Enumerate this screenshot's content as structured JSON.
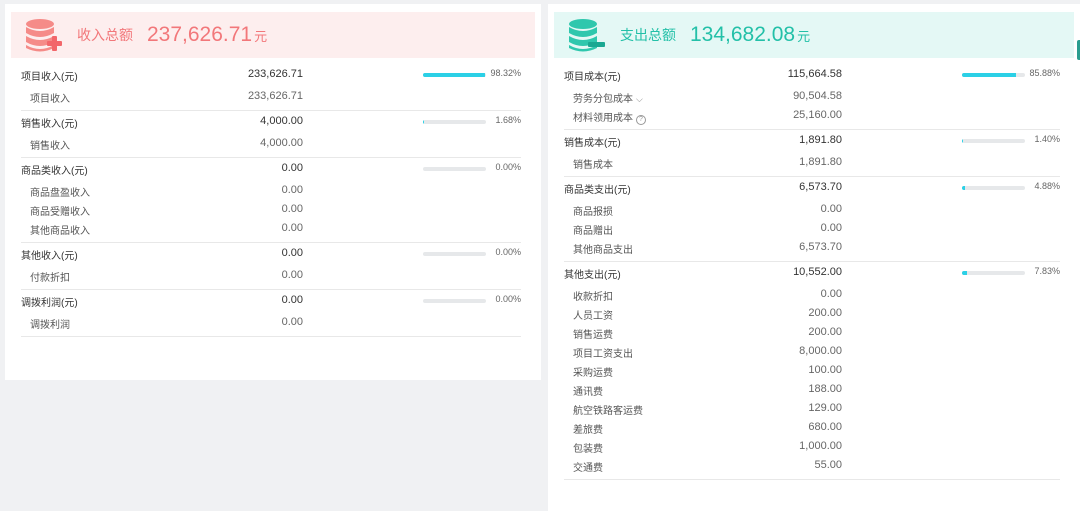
{
  "income": {
    "title": "收入总额",
    "total": "237,626.71",
    "unit": "元",
    "color": "#f2777a",
    "groups": [
      {
        "label": "项目收入(元)",
        "value": "233,626.71",
        "percent": "98.32%",
        "ratio": 0.9832,
        "items": [
          {
            "label": "项目收入",
            "value": "233,626.71"
          }
        ]
      },
      {
        "label": "销售收入(元)",
        "value": "4,000.00",
        "percent": "1.68%",
        "ratio": 0.0168,
        "items": [
          {
            "label": "销售收入",
            "value": "4,000.00"
          }
        ]
      },
      {
        "label": "商品类收入(元)",
        "value": "0.00",
        "percent": "0.00%",
        "ratio": 0,
        "items": [
          {
            "label": "商品盘盈收入",
            "value": "0.00"
          },
          {
            "label": "商品受赠收入",
            "value": "0.00"
          },
          {
            "label": "其他商品收入",
            "value": "0.00"
          }
        ]
      },
      {
        "label": "其他收入(元)",
        "value": "0.00",
        "percent": "0.00%",
        "ratio": 0,
        "items": [
          {
            "label": "付款折扣",
            "value": "0.00"
          }
        ]
      },
      {
        "label": "调拨利润(元)",
        "value": "0.00",
        "percent": "0.00%",
        "ratio": 0,
        "items": [
          {
            "label": "调拨利润",
            "value": "0.00"
          }
        ]
      }
    ]
  },
  "expense": {
    "title": "支出总额",
    "total": "134,682.08",
    "unit": "元",
    "color": "#23c0a8",
    "groups": [
      {
        "label": "项目成本(元)",
        "value": "115,664.58",
        "percent": "85.88%",
        "ratio": 0.8588,
        "items": [
          {
            "label": "劳务分包成本",
            "value": "90,504.58",
            "icon": "chevron-down-icon"
          },
          {
            "label": "材料领用成本",
            "value": "25,160.00",
            "icon": "help-icon"
          }
        ]
      },
      {
        "label": "销售成本(元)",
        "value": "1,891.80",
        "percent": "1.40%",
        "ratio": 0.014,
        "items": [
          {
            "label": "销售成本",
            "value": "1,891.80"
          }
        ]
      },
      {
        "label": "商品类支出(元)",
        "value": "6,573.70",
        "percent": "4.88%",
        "ratio": 0.0488,
        "items": [
          {
            "label": "商品报损",
            "value": "0.00"
          },
          {
            "label": "商品赠出",
            "value": "0.00"
          },
          {
            "label": "其他商品支出",
            "value": "6,573.70"
          }
        ]
      },
      {
        "label": "其他支出(元)",
        "value": "10,552.00",
        "percent": "7.83%",
        "ratio": 0.0783,
        "items": [
          {
            "label": "收款折扣",
            "value": "0.00"
          },
          {
            "label": "人员工资",
            "value": "200.00"
          },
          {
            "label": "销售运费",
            "value": "200.00"
          },
          {
            "label": "项目工资支出",
            "value": "8,000.00"
          },
          {
            "label": "采购运费",
            "value": "100.00"
          },
          {
            "label": "通讯费",
            "value": "188.00"
          },
          {
            "label": "航空铁路客运费",
            "value": "129.00"
          },
          {
            "label": "差旅费",
            "value": "680.00"
          },
          {
            "label": "包装费",
            "value": "1,000.00"
          },
          {
            "label": "交通费",
            "value": "55.00"
          }
        ]
      }
    ]
  }
}
